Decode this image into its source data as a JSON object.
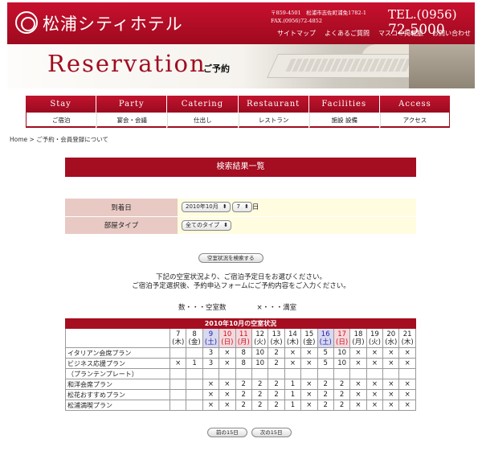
{
  "header": {
    "hotel_name": "松浦シティホテル",
    "address_line1": "〒859-4501　松浦市志佐町浦免1782-1",
    "address_line2": "FAX.(0956)72-4852",
    "tel_prefix": "TEL.(0956)",
    "tel_number": "72-5000",
    "links": [
      "サイトマップ",
      "よくあるご質問",
      "マスコミ掲載脈",
      "お問い合わせ"
    ]
  },
  "banner": {
    "title": "Reservation",
    "subtitle": "ご予約"
  },
  "nav": [
    {
      "en": "Stay",
      "jp": "ご宿泊"
    },
    {
      "en": "Party",
      "jp": "宴会・会議"
    },
    {
      "en": "Catering",
      "jp": "仕出し"
    },
    {
      "en": "Restaurant",
      "jp": "レストラン"
    },
    {
      "en": "Facilities",
      "jp": "施設 設備"
    },
    {
      "en": "Access",
      "jp": "アクセス"
    }
  ],
  "breadcrumb": {
    "home": "Home",
    "sep": " > ",
    "current": "ご予約・会員登録について"
  },
  "result_title": "検索結果一覧",
  "form": {
    "arrival_label": "到着日",
    "arrival_month": "2010年10月",
    "arrival_day": "7",
    "day_suffix": "日",
    "room_type_label": "部屋タイプ",
    "room_type_value": "全てのタイプ"
  },
  "search_button": "空室状況を検索する",
  "instructions": [
    "下記の空室状況より、ご宿泊予定日をお選びください。",
    "ご宿泊予定選択後、予約申込フォームにご予約内容をご入力ください。"
  ],
  "legend": {
    "number": "数・・・空室数",
    "full": "×・・・満室"
  },
  "calendar": {
    "caption": "2010年10月の空室状況",
    "days": [
      {
        "d": "7",
        "w": "(木)",
        "t": ""
      },
      {
        "d": "8",
        "w": "(金)",
        "t": ""
      },
      {
        "d": "9",
        "w": "(土)",
        "t": "sat"
      },
      {
        "d": "10",
        "w": "(日)",
        "t": "sun"
      },
      {
        "d": "11",
        "w": "(月)",
        "t": "sun"
      },
      {
        "d": "12",
        "w": "(火)",
        "t": ""
      },
      {
        "d": "13",
        "w": "(水)",
        "t": ""
      },
      {
        "d": "14",
        "w": "(木)",
        "t": ""
      },
      {
        "d": "15",
        "w": "(金)",
        "t": ""
      },
      {
        "d": "16",
        "w": "(土)",
        "t": "sat"
      },
      {
        "d": "17",
        "w": "(日)",
        "t": "sun"
      },
      {
        "d": "18",
        "w": "(月)",
        "t": ""
      },
      {
        "d": "19",
        "w": "(火)",
        "t": ""
      },
      {
        "d": "20",
        "w": "(水)",
        "t": ""
      },
      {
        "d": "21",
        "w": "(木)",
        "t": ""
      }
    ],
    "plans": [
      {
        "name": "イタリアン会席プラン",
        "cells": [
          "",
          "",
          "3",
          "×",
          "8",
          "10",
          "2",
          "×",
          "×",
          "5",
          "10",
          "×",
          "×",
          "×",
          "×"
        ]
      },
      {
        "name": "ビジネス応援プラン",
        "cells": [
          "×",
          "1",
          "3",
          "×",
          "8",
          "10",
          "2",
          "×",
          "×",
          "5",
          "10",
          "×",
          "×",
          "×",
          "×"
        ]
      },
      {
        "name": "（プランテンプレート）",
        "cells": [
          "",
          "",
          "",
          "",
          "",
          "",
          "",
          "",
          "",
          "",
          "",
          "",
          "",
          "",
          ""
        ]
      },
      {
        "name": "和洋会席プラン",
        "cells": [
          "",
          "",
          "×",
          "×",
          "2",
          "2",
          "2",
          "1",
          "×",
          "2",
          "2",
          "×",
          "×",
          "×",
          "×"
        ]
      },
      {
        "name": "松花おすすめプラン",
        "cells": [
          "",
          "",
          "×",
          "×",
          "2",
          "2",
          "2",
          "1",
          "×",
          "2",
          "2",
          "×",
          "×",
          "×",
          "×"
        ]
      },
      {
        "name": "松浦満喫プラン",
        "cells": [
          "",
          "",
          "×",
          "×",
          "2",
          "2",
          "2",
          "1",
          "×",
          "2",
          "2",
          "×",
          "×",
          "×",
          "×"
        ]
      }
    ]
  },
  "pager": {
    "prev": "前の15日",
    "next": "次の15日"
  },
  "colors": {
    "brand_red": "#a50d20",
    "label_pink": "#e8c9c4",
    "value_yellow": "#fffce0",
    "saturday_blue": "#2222aa",
    "sunday_red": "#cc1122"
  }
}
